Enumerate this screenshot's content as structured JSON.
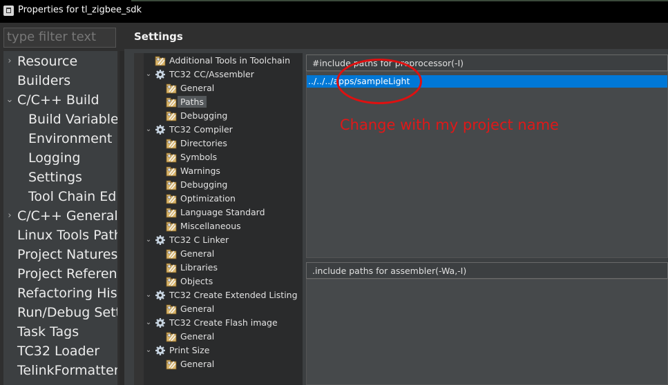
{
  "window": {
    "title": "Properties for tl_zigbee_sdk"
  },
  "filter": {
    "placeholder": "type filter text"
  },
  "nav": {
    "items": [
      {
        "label": "Resource",
        "expand": "›",
        "indent": 0,
        "has_arrow": true
      },
      {
        "label": "Builders",
        "expand": "",
        "indent": 0,
        "has_arrow": false
      },
      {
        "label": "C/C++ Build",
        "expand": "⌄",
        "indent": 0,
        "has_arrow": true
      },
      {
        "label": "Build Variables",
        "expand": "",
        "indent": 1,
        "has_arrow": false
      },
      {
        "label": "Environment",
        "expand": "",
        "indent": 1,
        "has_arrow": false
      },
      {
        "label": "Logging",
        "expand": "",
        "indent": 1,
        "has_arrow": false
      },
      {
        "label": "Settings",
        "expand": "",
        "indent": 1,
        "has_arrow": false
      },
      {
        "label": "Tool Chain Editor",
        "expand": "",
        "indent": 1,
        "has_arrow": false
      },
      {
        "label": "C/C++ General",
        "expand": "›",
        "indent": 0,
        "has_arrow": true
      },
      {
        "label": "Linux Tools Path",
        "expand": "",
        "indent": 0,
        "has_arrow": false
      },
      {
        "label": "Project Natures",
        "expand": "",
        "indent": 0,
        "has_arrow": false
      },
      {
        "label": "Project References",
        "expand": "",
        "indent": 0,
        "has_arrow": false
      },
      {
        "label": "Refactoring History",
        "expand": "",
        "indent": 0,
        "has_arrow": false
      },
      {
        "label": "Run/Debug Settings",
        "expand": "",
        "indent": 0,
        "has_arrow": false
      },
      {
        "label": "Task Tags",
        "expand": "",
        "indent": 0,
        "has_arrow": false
      },
      {
        "label": "TC32 Loader",
        "expand": "",
        "indent": 0,
        "has_arrow": false
      },
      {
        "label": "TelinkFormatter",
        "expand": "",
        "indent": 0,
        "has_arrow": false
      }
    ]
  },
  "settings": {
    "title": "Settings"
  },
  "tool_tree": {
    "items": [
      {
        "label": "Additional Tools in Toolchain",
        "level": 0,
        "kind": "option",
        "arrow": ""
      },
      {
        "label": "TC32 CC/Assembler",
        "level": 0,
        "kind": "tool",
        "arrow": "⌄"
      },
      {
        "label": "General",
        "level": 1,
        "kind": "option",
        "arrow": ""
      },
      {
        "label": "Paths",
        "level": 1,
        "kind": "option",
        "arrow": "",
        "selected": true
      },
      {
        "label": "Debugging",
        "level": 1,
        "kind": "option",
        "arrow": ""
      },
      {
        "label": "TC32 Compiler",
        "level": 0,
        "kind": "tool",
        "arrow": "⌄"
      },
      {
        "label": "Directories",
        "level": 1,
        "kind": "option",
        "arrow": ""
      },
      {
        "label": "Symbols",
        "level": 1,
        "kind": "option",
        "arrow": ""
      },
      {
        "label": "Warnings",
        "level": 1,
        "kind": "option",
        "arrow": ""
      },
      {
        "label": "Debugging",
        "level": 1,
        "kind": "option",
        "arrow": ""
      },
      {
        "label": "Optimization",
        "level": 1,
        "kind": "option",
        "arrow": ""
      },
      {
        "label": "Language Standard",
        "level": 1,
        "kind": "option",
        "arrow": ""
      },
      {
        "label": "Miscellaneous",
        "level": 1,
        "kind": "option",
        "arrow": ""
      },
      {
        "label": "TC32 C Linker",
        "level": 0,
        "kind": "tool",
        "arrow": "⌄"
      },
      {
        "label": "General",
        "level": 1,
        "kind": "option",
        "arrow": ""
      },
      {
        "label": "Libraries",
        "level": 1,
        "kind": "option",
        "arrow": ""
      },
      {
        "label": "Objects",
        "level": 1,
        "kind": "option",
        "arrow": ""
      },
      {
        "label": "TC32 Create Extended Listing",
        "level": 0,
        "kind": "tool",
        "arrow": "⌄"
      },
      {
        "label": "General",
        "level": 1,
        "kind": "option",
        "arrow": ""
      },
      {
        "label": "TC32 Create Flash image",
        "level": 0,
        "kind": "tool",
        "arrow": "⌄"
      },
      {
        "label": "General",
        "level": 1,
        "kind": "option",
        "arrow": ""
      },
      {
        "label": "Print Size",
        "level": 0,
        "kind": "tool",
        "arrow": "⌄"
      },
      {
        "label": "General",
        "level": 1,
        "kind": "option",
        "arrow": ""
      }
    ]
  },
  "preprocessor_paths": {
    "header": "#include paths for preprocessor(-I)",
    "entries": [
      "../../../apps/sampleLight"
    ]
  },
  "assembler_paths": {
    "header": ".include paths for assembler(-Wa,-I)"
  },
  "annotation": {
    "text": "Change with my project name",
    "color": "#e01818"
  },
  "colors": {
    "selection": "#0078d7",
    "panel": "#3c3f41",
    "titlebar": "#000000"
  }
}
